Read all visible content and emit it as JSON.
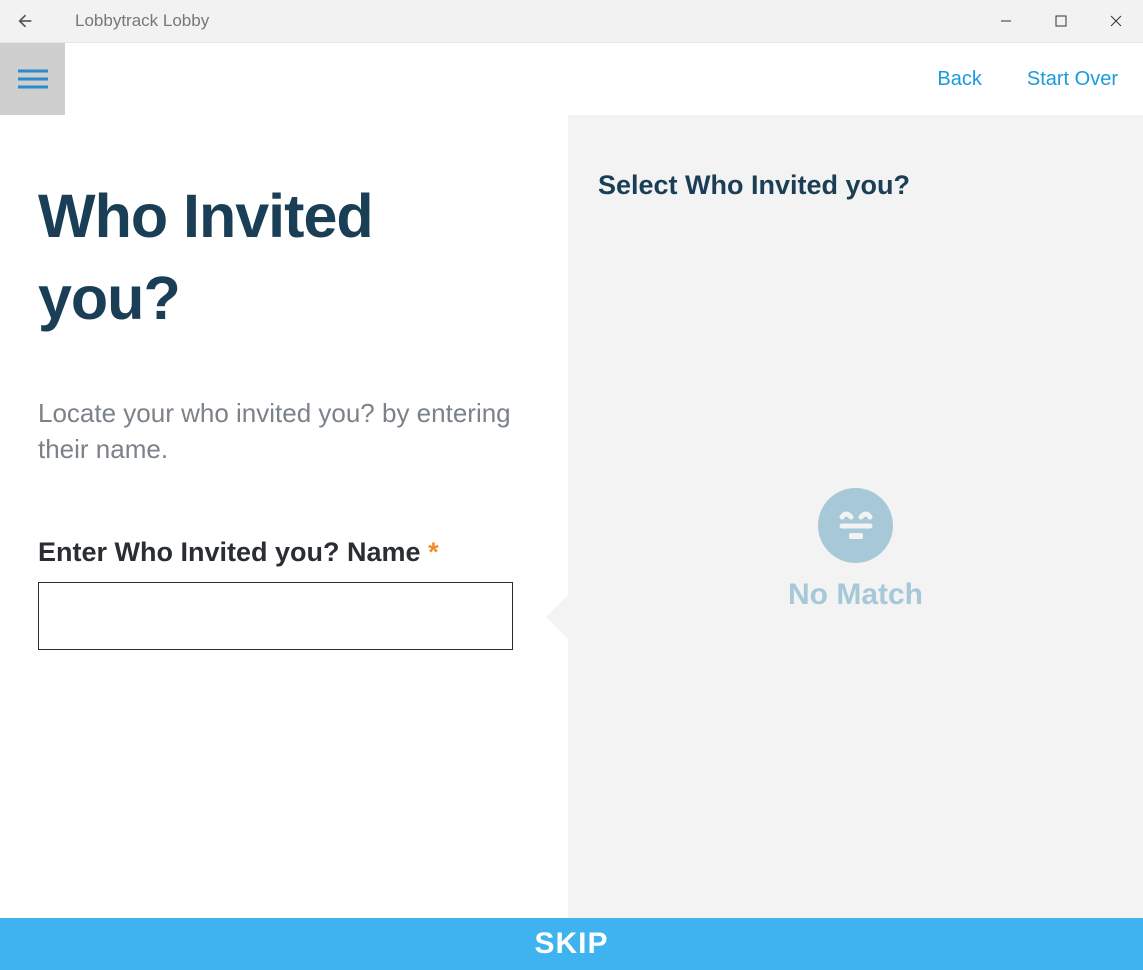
{
  "window": {
    "title": "Lobbytrack Lobby"
  },
  "appbar": {
    "back_label": "Back",
    "startover_label": "Start Over"
  },
  "left": {
    "heading": "Who Invited you?",
    "subtext": "Locate your who invited you? by entering their name.",
    "field_label": "Enter Who Invited you? Name",
    "required_mark": "*",
    "input_value": ""
  },
  "right": {
    "heading": "Select Who Invited you?",
    "empty_label": "No Match"
  },
  "footer": {
    "skip_label": "SKIP"
  }
}
